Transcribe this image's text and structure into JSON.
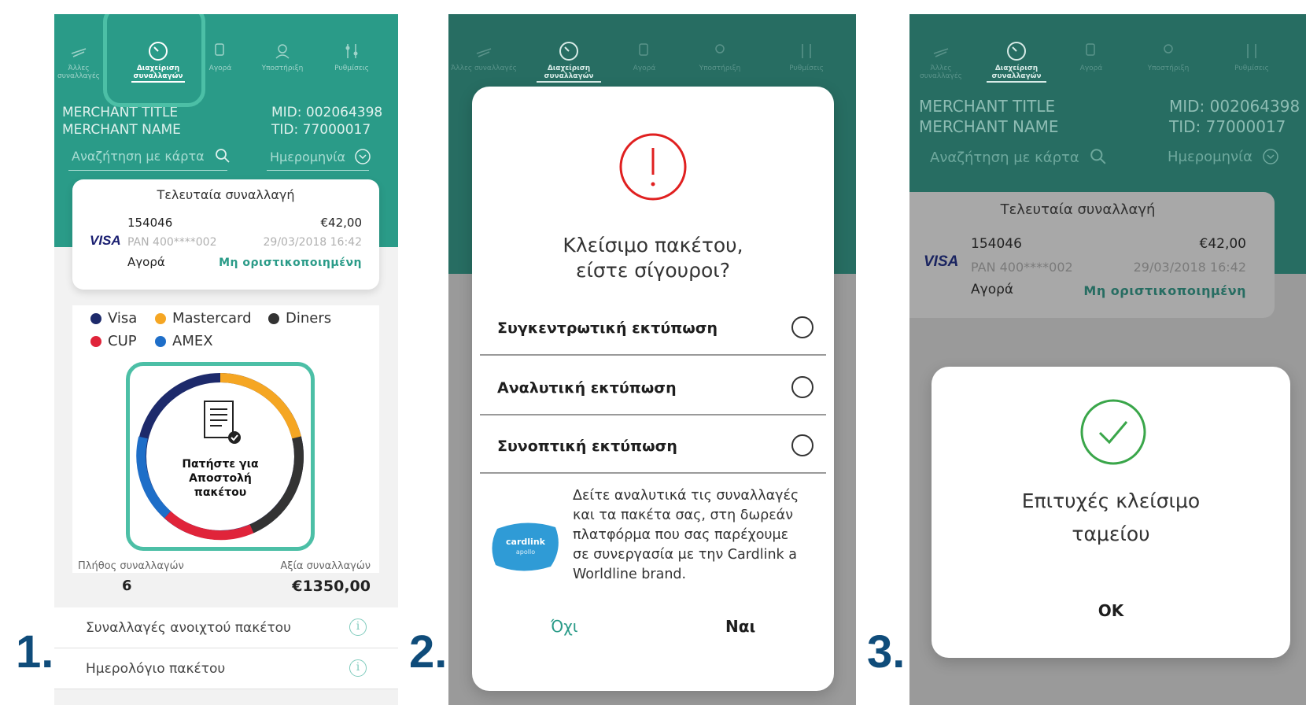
{
  "colors": {
    "teal": "#2a9b88",
    "highlight": "#4cbfa6",
    "step_number": "#0f4c7a",
    "error_red": "#e02020",
    "success_green": "#3aa64a",
    "visa": "#1a1f71"
  },
  "steps": [
    "1.",
    "2.",
    "3."
  ],
  "nav": {
    "items": [
      {
        "label": "Άλλες συναλλαγές",
        "icon": "other-transactions-icon"
      },
      {
        "label": "Διαχείριση συναλλαγών",
        "icon": "clock-icon"
      },
      {
        "label": "Αγορά",
        "icon": "hand-card-icon"
      },
      {
        "label": "Υποστήριξη",
        "icon": "support-agent-icon"
      },
      {
        "label": "Ρυθμίσεις",
        "icon": "settings-sliders-icon"
      }
    ]
  },
  "merchant": {
    "title": "MERCHANT TITLE",
    "name": "MERCHANT NAME",
    "mid": "MID: 002064398",
    "tid": "TID: 77000017"
  },
  "search": {
    "card_placeholder": "Αναζήτηση με κάρτα",
    "date_label": "Ημερομηνία"
  },
  "last_transaction": {
    "header": "Τελευταία συναλλαγή",
    "brand": "VISA",
    "id": "154046",
    "amount": "€42,00",
    "pan": "PAN 400****002",
    "datetime": "29/03/2018 16:42",
    "type": "Αγορά",
    "status": "Μη οριστικοποιημένη"
  },
  "legend": [
    {
      "label": "Visa",
      "color": "#1d2a6b"
    },
    {
      "label": "Mastercard",
      "color": "#f5a623"
    },
    {
      "label": "Diners",
      "color": "#333333"
    },
    {
      "label": "CUP",
      "color": "#e0243a"
    },
    {
      "label": "AMEX",
      "color": "#1e6ec8"
    }
  ],
  "donut": {
    "line1": "Πατήστε για",
    "line2": "Αποστολή",
    "line3": "πακέτου",
    "icon": "receipt-check-icon"
  },
  "stats": {
    "count_label": "Πλήθος συναλλαγών",
    "count_value": "6",
    "value_label": "Αξία συναλλαγών",
    "value_amount": "€1350,00"
  },
  "footer": {
    "open_batch": "Συναλλαγές ανοιχτού πακέτου",
    "batch_log": "Ημερολόγιο πακέτου"
  },
  "close_modal": {
    "title_line1": "Κλείσιμο πακέτου,",
    "title_line2": "είστε σίγουροι?",
    "options": [
      "Συγκεντρωτική εκτύπωση",
      "Αναλυτική εκτύπωση",
      "Συνοπτική εκτύπωση"
    ],
    "promo_lines": [
      "Δείτε αναλυτικά τις συναλλαγές",
      "και τα πακέτα σας, στη δωρεάν",
      "πλατφόρμα που σας παρέχουμε",
      "σε συνεργασία με την Cardlink a",
      "Worldline brand."
    ],
    "logo_text_1": "cardlink",
    "logo_text_2": "apollo",
    "no_label": "Όχι",
    "yes_label": "Ναι"
  },
  "success_modal": {
    "line1": "Επιτυχές κλείσιμο",
    "line2": "ταμείου",
    "ok_label": "OK"
  }
}
